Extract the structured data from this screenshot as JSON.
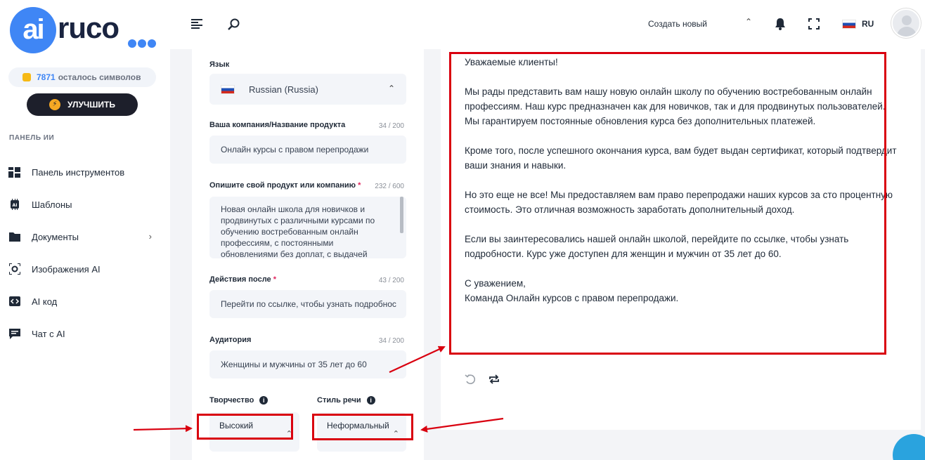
{
  "brand": {
    "logo_left": "ai",
    "logo_right": "ruco"
  },
  "sidebar": {
    "credits_count": "7871",
    "credits_label": "осталось символов",
    "upgrade_label": "УЛУЧШИТЬ",
    "section_label": "ПАНЕЛЬ ИИ",
    "items": [
      {
        "label": "Панель инструментов",
        "icon": "dashboard-icon"
      },
      {
        "label": "Шаблоны",
        "icon": "ai-chip-icon"
      },
      {
        "label": "Документы",
        "icon": "folder-icon"
      },
      {
        "label": "Изображения AI",
        "icon": "camera-icon"
      },
      {
        "label": "AI код",
        "icon": "code-icon"
      },
      {
        "label": "Чат с AI",
        "icon": "chat-icon"
      }
    ]
  },
  "header": {
    "create_new": "Создать новый",
    "language": "RU"
  },
  "form": {
    "language_label": "Язык",
    "language_value": "Russian (Russia)",
    "company_label": "Ваша компания/Название продукта",
    "company_count": "34 / 200",
    "company_value": "Онлайн курсы с правом перепродажи",
    "describe_label": "Опишите свой продукт или компанию",
    "describe_count": "232 / 600",
    "describe_value": "Новая онлайн школа для новичков и продвинутых с различными курсами по обучению востребованным онлайн профессиям, с постоянными обновлениями без доплат, с выдачей",
    "actions_label": "Действия после",
    "actions_count": "43 / 200",
    "actions_value": "Перейти по ссылке, чтобы узнать подробнос",
    "audience_label": "Аудитория",
    "audience_count": "34 / 200",
    "audience_value": "Женщины и мужчины от 35 лет до 60",
    "creativity_label": "Творчество",
    "creativity_value": "Высокий",
    "tone_label": "Стиль речи",
    "tone_value": "Неформальный",
    "required_mark": "*"
  },
  "output": {
    "greeting": "Уважаемые клиенты!",
    "p1": "Мы рады представить вам нашу новую онлайн школу по обучению востребованным онлайн профессиям. Наш курс предназначен как для новичков, так и для продвинутых пользователей. Мы гарантируем постоянные обновления курса без дополнительных платежей.",
    "p2": "Кроме того, после успешного окончания курса, вам будет выдан сертификат, который подтвердит ваши знания и навыки.",
    "p3": "Но это еще не все! Мы предоставляем вам право перепродажи наших курсов за сто процентную стоимость. Это отличная возможность заработать дополнительный доход.",
    "p4": "Если вы заинтересовались нашей онлайн школой, перейдите по ссылке, чтобы узнать подробности. Курс уже доступен для женщин и мужчин от 35 лет до 60.",
    "sign1": "С уважением,",
    "sign2": "Команда Онлайн курсов с правом перепродажи."
  },
  "colors": {
    "accent": "#3f86f5",
    "annotation": "#d9000f",
    "dark_button": "#1d1f2b"
  }
}
